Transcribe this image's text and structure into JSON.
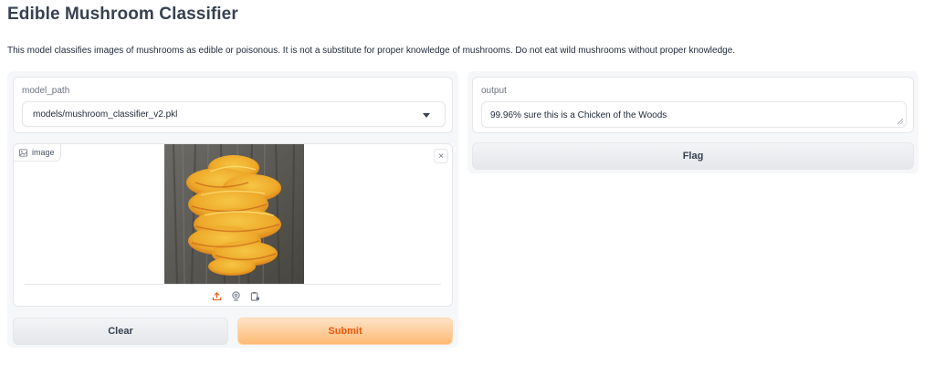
{
  "page": {
    "title": "Edible Mushroom Classifier",
    "description": "This model classifies images of mushrooms as edible or poisonous. It is not a substitute for proper knowledge of mushrooms. Do not eat wild mushrooms without proper knowledge."
  },
  "inputs": {
    "model_path": {
      "label": "model_path",
      "value": "models/mushroom_classifier_v2.pkl"
    },
    "image": {
      "label": "image",
      "close_symbol": "×",
      "tools": [
        "upload-icon",
        "webcam-icon",
        "clipboard-icon"
      ]
    },
    "buttons": {
      "clear": "Clear",
      "submit": "Submit"
    }
  },
  "outputs": {
    "output": {
      "label": "output",
      "value": "99.96% sure this is a Chicken of the Woods"
    },
    "flag": "Flag"
  },
  "colors": {
    "accent": "#ea580c",
    "primary_button": "#fdba74",
    "panel": "#f6f7f9"
  }
}
